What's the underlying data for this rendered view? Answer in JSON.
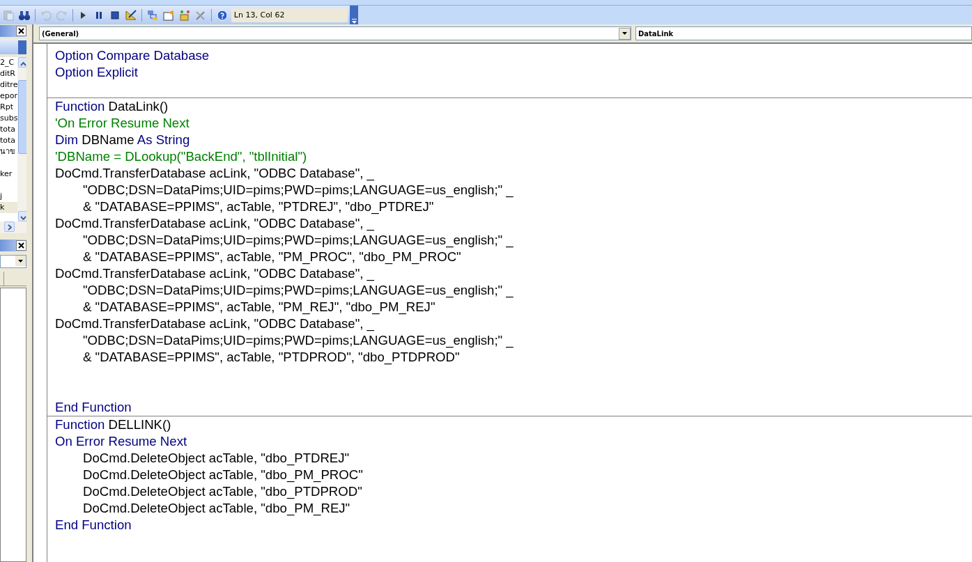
{
  "toolbar": {
    "buttons": [
      {
        "kind": "paste",
        "disabled": true
      },
      {
        "kind": "find",
        "disabled": false
      },
      {
        "kind": "sep"
      },
      {
        "kind": "undo",
        "disabled": true
      },
      {
        "kind": "redo",
        "disabled": true
      },
      {
        "kind": "sep"
      },
      {
        "kind": "run",
        "disabled": false
      },
      {
        "kind": "pause",
        "disabled": false
      },
      {
        "kind": "stop",
        "disabled": false
      },
      {
        "kind": "design",
        "disabled": false
      },
      {
        "kind": "sep"
      },
      {
        "kind": "explorer",
        "disabled": false
      },
      {
        "kind": "properties",
        "disabled": false
      },
      {
        "kind": "browser",
        "disabled": false
      },
      {
        "kind": "toolbox",
        "disabled": false
      },
      {
        "kind": "sep"
      },
      {
        "kind": "help",
        "disabled": false
      }
    ],
    "position": "Ln 13, Col 62"
  },
  "project_panel": {
    "items": [
      {
        "label": "2_C",
        "selected": false
      },
      {
        "label": "ditR",
        "selected": false
      },
      {
        "label": "ditre",
        "selected": false
      },
      {
        "label": "epor",
        "selected": false
      },
      {
        "label": "Rpt",
        "selected": false
      },
      {
        "label": "subs",
        "selected": false
      },
      {
        "label": "tota",
        "selected": false
      },
      {
        "label": "tota",
        "selected": false
      },
      {
        "label": "นาข",
        "selected": false
      },
      {
        "selected": false
      },
      {
        "label": "ker",
        "selected": false
      },
      {
        "selected": false
      },
      {
        "label": "j",
        "selected": false
      },
      {
        "label": "k",
        "selected": true
      }
    ]
  },
  "code_window": {
    "object_combo": "(General)",
    "procedure_combo": "DataLink",
    "procedures": [
      {
        "lines": [
          {
            "kind": "code",
            "indent": false,
            "segments": [
              {
                "kind": "keyword",
                "text": "Option Compare Database"
              }
            ]
          },
          {
            "kind": "code",
            "indent": false,
            "segments": [
              {
                "kind": "keyword",
                "text": "Option Explicit"
              }
            ]
          },
          {
            "kind": "blank"
          }
        ]
      },
      {
        "lines": [
          {
            "kind": "code",
            "indent": false,
            "segments": [
              {
                "kind": "keyword",
                "text": "Function"
              },
              {
                "kind": "plain",
                "text": " DataLink()"
              }
            ]
          },
          {
            "kind": "code",
            "indent": false,
            "segments": [
              {
                "kind": "comment",
                "text": "'On Error Resume Next"
              }
            ]
          },
          {
            "kind": "code",
            "indent": false,
            "segments": [
              {
                "kind": "keyword",
                "text": "Dim"
              },
              {
                "kind": "plain",
                "text": " DBName "
              },
              {
                "kind": "keyword",
                "text": "As String"
              }
            ]
          },
          {
            "kind": "code",
            "indent": false,
            "segments": [
              {
                "kind": "comment",
                "text": "'DBName = DLookup(\"BackEnd\", \"tblInitial\")"
              }
            ]
          },
          {
            "kind": "code",
            "indent": false,
            "segments": [
              {
                "kind": "plain",
                "text": "DoCmd.TransferDatabase acLink, \"ODBC Database\", _"
              }
            ]
          },
          {
            "kind": "code",
            "indent": true,
            "segments": [
              {
                "kind": "plain",
                "text": "\"ODBC;DSN=DataPims;UID=pims;PWD=pims;LANGUAGE=us_english;\" _"
              }
            ]
          },
          {
            "kind": "code",
            "indent": true,
            "segments": [
              {
                "kind": "plain",
                "text": "& \"DATABASE=PPIMS\", acTable, \"PTDREJ\", \"dbo_PTDREJ\""
              }
            ]
          },
          {
            "kind": "code",
            "indent": false,
            "segments": [
              {
                "kind": "plain",
                "text": "DoCmd.TransferDatabase acLink, \"ODBC Database\", _"
              }
            ]
          },
          {
            "kind": "code",
            "indent": true,
            "segments": [
              {
                "kind": "plain",
                "text": "\"ODBC;DSN=DataPims;UID=pims;PWD=pims;LANGUAGE=us_english;\" _"
              }
            ]
          },
          {
            "kind": "code",
            "indent": true,
            "segments": [
              {
                "kind": "plain",
                "text": "& \"DATABASE=PPIMS\", acTable, \"PM_PROC\", \"dbo_PM_PROC\""
              }
            ]
          },
          {
            "kind": "code",
            "indent": false,
            "segments": [
              {
                "kind": "plain",
                "text": "DoCmd.TransferDatabase acLink, \"ODBC Database\", _"
              }
            ]
          },
          {
            "kind": "code",
            "indent": true,
            "segments": [
              {
                "kind": "plain",
                "text": "\"ODBC;DSN=DataPims;UID=pims;PWD=pims;LANGUAGE=us_english;\" _"
              }
            ]
          },
          {
            "kind": "code",
            "indent": true,
            "segments": [
              {
                "kind": "plain",
                "text": "& \"DATABASE=PPIMS\", acTable, \"PM_REJ\", \"dbo_PM_REJ\""
              }
            ]
          },
          {
            "kind": "code",
            "indent": false,
            "segments": [
              {
                "kind": "plain",
                "text": "DoCmd.TransferDatabase acLink, \"ODBC Database\", _"
              }
            ]
          },
          {
            "kind": "code",
            "indent": true,
            "segments": [
              {
                "kind": "plain",
                "text": "\"ODBC;DSN=DataPims;UID=pims;PWD=pims;LANGUAGE=us_english;\" _"
              }
            ]
          },
          {
            "kind": "code",
            "indent": true,
            "segments": [
              {
                "kind": "plain",
                "text": "& \"DATABASE=PPIMS\", acTable, \"PTDPROD\", \"dbo_PTDPROD\""
              }
            ]
          },
          {
            "kind": "blank"
          },
          {
            "kind": "blank"
          },
          {
            "kind": "code",
            "indent": false,
            "segments": [
              {
                "kind": "keyword",
                "text": "End Function"
              }
            ]
          }
        ]
      },
      {
        "lines": [
          {
            "kind": "code",
            "indent": false,
            "segments": [
              {
                "kind": "keyword",
                "text": "Function"
              },
              {
                "kind": "plain",
                "text": " DELLINK()"
              }
            ]
          },
          {
            "kind": "code",
            "indent": false,
            "segments": [
              {
                "kind": "keyword",
                "text": "On Error Resume Next"
              }
            ]
          },
          {
            "kind": "code",
            "indent": true,
            "segments": [
              {
                "kind": "plain",
                "text": "DoCmd.DeleteObject acTable, \"dbo_PTDREJ\""
              }
            ]
          },
          {
            "kind": "code",
            "indent": true,
            "segments": [
              {
                "kind": "plain",
                "text": "DoCmd.DeleteObject acTable, \"dbo_PM_PROC\""
              }
            ]
          },
          {
            "kind": "code",
            "indent": true,
            "segments": [
              {
                "kind": "plain",
                "text": "DoCmd.DeleteObject acTable, \"dbo_PTDPROD\""
              }
            ]
          },
          {
            "kind": "code",
            "indent": true,
            "segments": [
              {
                "kind": "plain",
                "text": "DoCmd.DeleteObject acTable, \"dbo_PM_REJ\""
              }
            ]
          },
          {
            "kind": "code",
            "indent": false,
            "segments": [
              {
                "kind": "keyword",
                "text": "End Function"
              }
            ]
          }
        ]
      }
    ]
  }
}
